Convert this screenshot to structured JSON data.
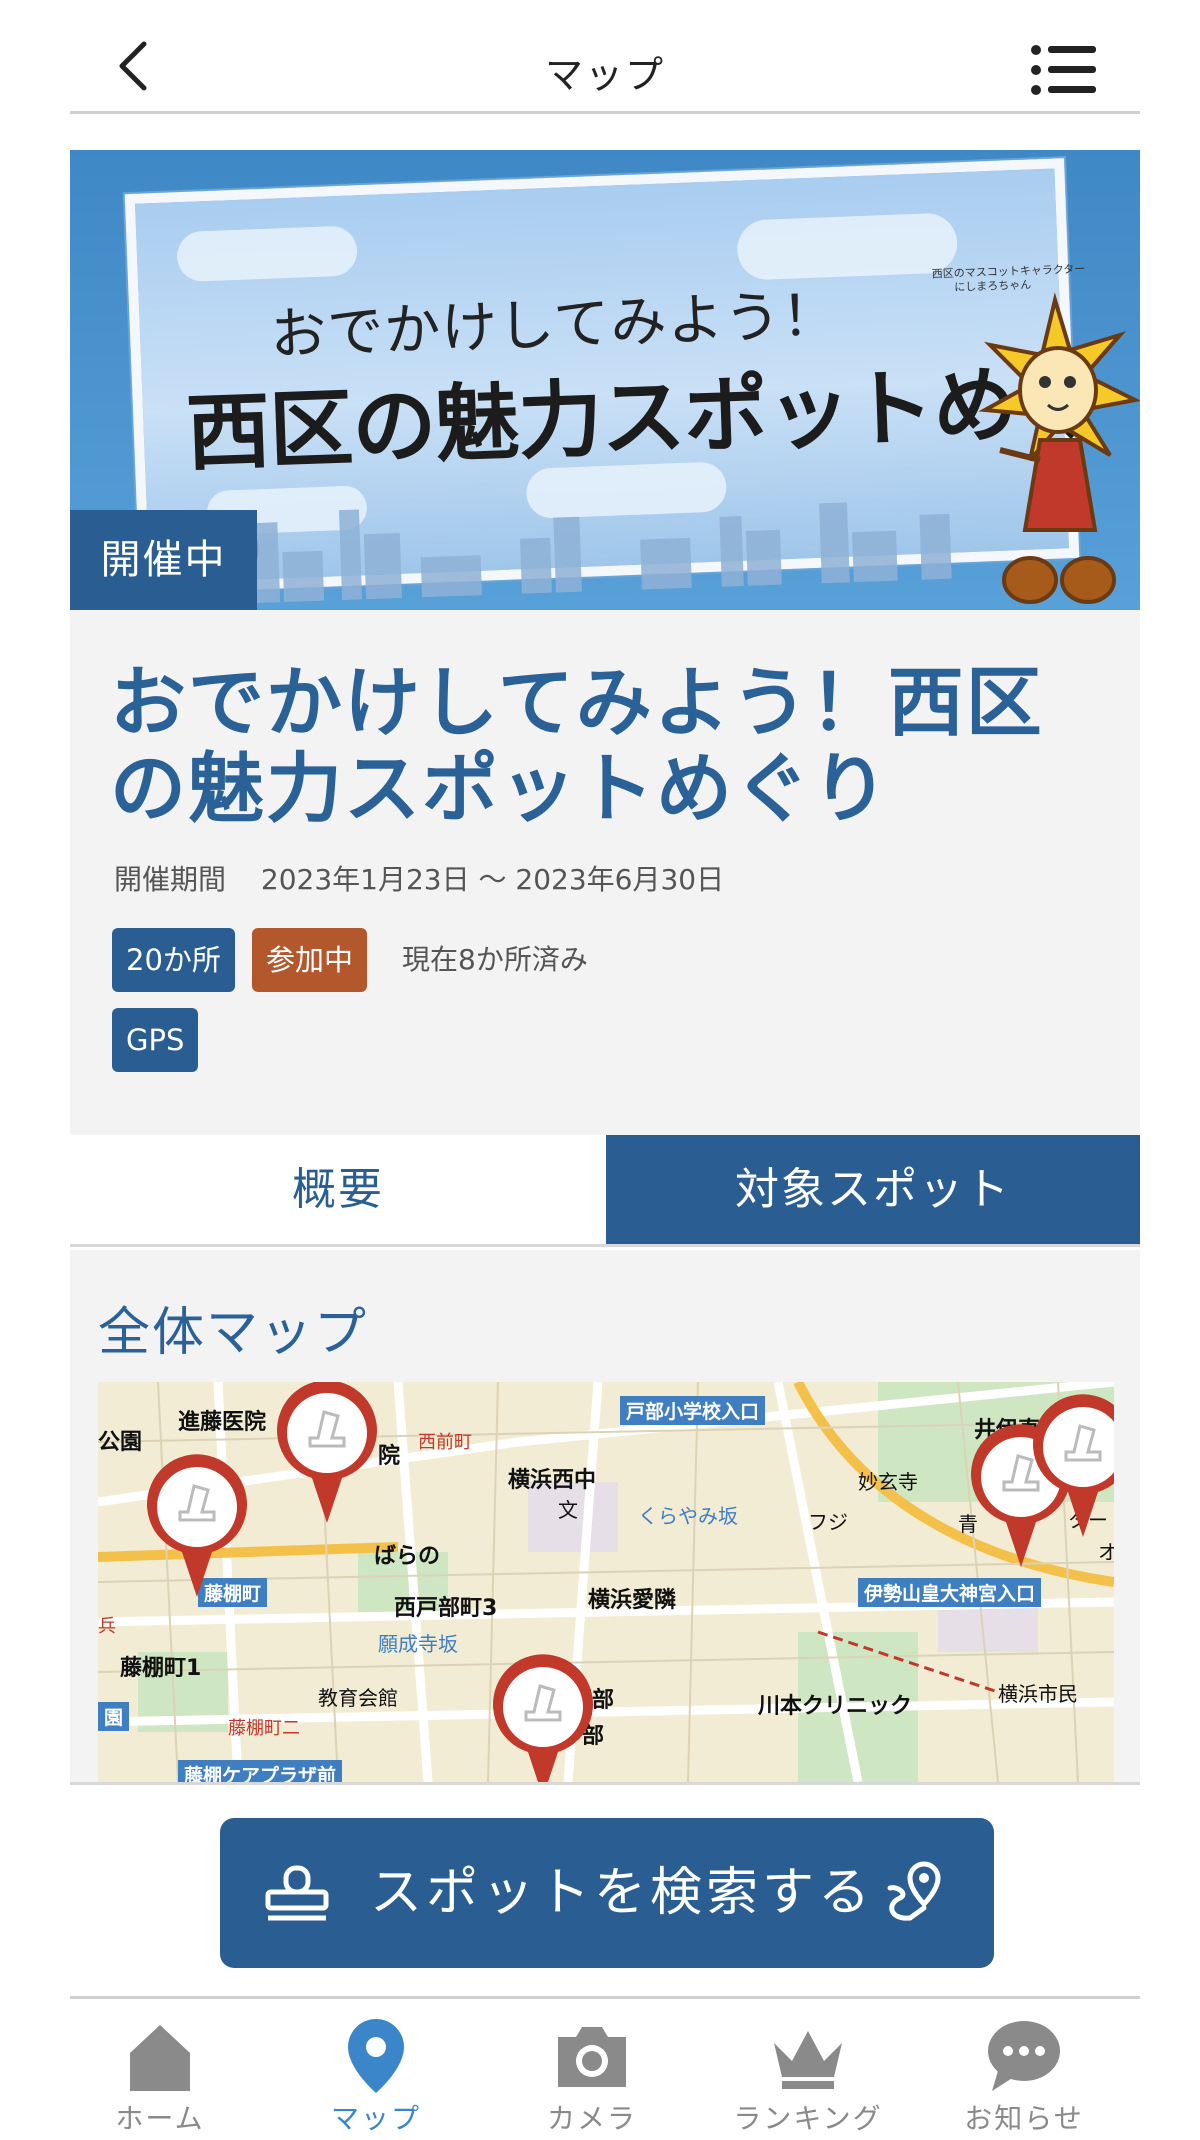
{
  "header": {
    "title": "マップ",
    "back_icon": "chevron-left-icon",
    "menu_icon": "hamburger-menu-icon"
  },
  "banner": {
    "line1": "おでかけしてみよう！",
    "line2": "西区の魅力スポットめぐり",
    "mascot_caption_1": "西区のマスコットキャラクター",
    "mascot_caption_2": "にしまろちゃん",
    "status_badge": "開催中"
  },
  "event": {
    "title": "おでかけしてみよう！西区の魅力スポットめぐり",
    "period_label": "開催期間",
    "period_value": "2023年1月23日 ～ 2023年6月30日",
    "spot_count_tag": "20か所",
    "joined_tag": "参加中",
    "progress_text": "現在8か所済み",
    "gps_tag": "GPS"
  },
  "tabs": {
    "overview": "概要",
    "spots": "対象スポット",
    "active": "spots"
  },
  "map_section": {
    "heading": "全体マップ",
    "labels": {
      "shindo": "進藤医院",
      "park": "公園",
      "in": "院",
      "nishimae": "西前町",
      "tobe_school": "戸部小学校入口",
      "ii": "井伊直",
      "yokohama_nishi": "横浜西中",
      "bun": "文",
      "kurayami": "くらやみ坂",
      "myogen": "妙玄寺",
      "fuji": "フジ",
      "ao": "青",
      "ta": "ター",
      "o": "オ",
      "barano": "ばらの",
      "fujidanacho_st": "藤棚町",
      "nishitobe3": "西戸部町3",
      "yokohama_airin": "横浜愛隣",
      "ise": "伊勢山皇大神宮入口",
      "fujidana1": "藤棚町1",
      "ganjoji": "願成寺坂",
      "hei": "兵",
      "kyoiku": "教育会館",
      "nishitobe_a": "西戸部",
      "kawamoto": "川本クリニック",
      "shimin": "横浜市民",
      "en": "園",
      "fujidana2": "藤棚町二",
      "nishitobe_b": "西戸部",
      "care": "藤棚ケアプラザ前"
    }
  },
  "search_button": {
    "label": "スポットを検索する",
    "left_icon": "stamp-icon",
    "right_icon": "map-pin-route-icon"
  },
  "nav": {
    "items": [
      {
        "label": "ホーム",
        "icon": "home-icon"
      },
      {
        "label": "マップ",
        "icon": "map-pin-icon"
      },
      {
        "label": "カメラ",
        "icon": "camera-icon"
      },
      {
        "label": "ランキング",
        "icon": "crown-icon"
      },
      {
        "label": "お知らせ",
        "icon": "chat-bubble-icon"
      }
    ],
    "active_index": 1
  },
  "colors": {
    "primary": "#2a5e92",
    "joined": "#b3582c",
    "active_nav": "#3a86c8",
    "inactive_nav": "#8a8a8a",
    "pin_red": "#c0392b"
  }
}
